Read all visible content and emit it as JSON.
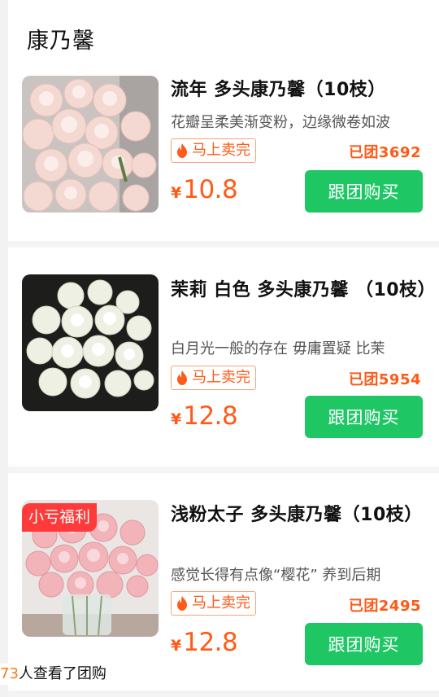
{
  "section": {
    "title": "康乃馨"
  },
  "products": [
    {
      "title": "流年 多头康乃馨（10枝）",
      "desc": "花瓣呈柔美渐变粉，边缘微卷如波",
      "badge": "马上卖完",
      "group_count": "已团3692",
      "currency": "¥",
      "price": "10.8",
      "button": "跟团购买",
      "image": "pink-carnation-bouquet",
      "promo": ""
    },
    {
      "title": "茉莉 白色 多头康乃馨 （10枝）",
      "desc": "白月光一般的存在 毋庸置疑 比茉",
      "badge": "马上卖完",
      "group_count": "已团5954",
      "currency": "¥",
      "price": "12.8",
      "button": "跟团购买",
      "image": "white-carnation-bouquet",
      "promo": ""
    },
    {
      "title": "浅粉太子 多头康乃馨（10枝）",
      "desc": "感觉长得有点像“樱花” 养到后期",
      "badge": "马上卖完",
      "group_count": "已团2495",
      "currency": "¥",
      "price": "12.8",
      "button": "跟团购买",
      "image": "light-pink-carnation-vase",
      "promo": "小亏福利"
    }
  ],
  "toast": {
    "count": "73",
    "text": "人查看了团购"
  },
  "colors": {
    "accent": "#ff5a17",
    "button": "#1ec764",
    "promo": "#ff3a3a"
  }
}
